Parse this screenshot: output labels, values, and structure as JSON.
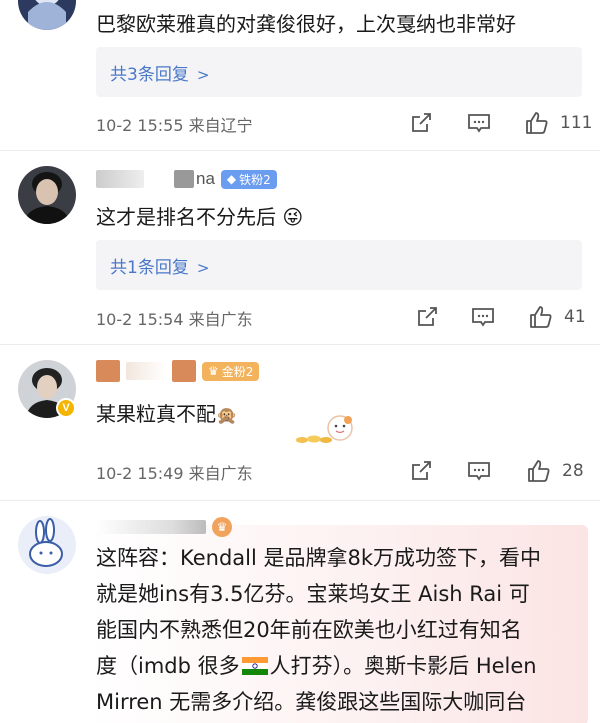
{
  "comments": [
    {
      "text": "巴黎欧莱雅真的对龚俊很好，上次戛纳也非常好",
      "reply_label": "共3条回复",
      "meta": "10-2 15:55 来自辽宁",
      "likes": "111"
    },
    {
      "badge": "铁粉2",
      "name_suffix": "na",
      "text": "这才是排名不分先后",
      "emoji": "😜",
      "reply_label": "共1条回复",
      "meta": "10-2 15:54 来自广东",
      "likes": "41"
    },
    {
      "badge": "金粉2",
      "text": "某果粒真不配",
      "emoji": "🙊",
      "meta": "10-2 15:49 来自广东",
      "likes": "28"
    },
    {
      "lines": [
        "这阵容：Kendall 是品牌拿8k万成功签下，看中",
        "就是她ins有3.5亿芬。宝莱坞女王 Aish Rai 可",
        "能国内不熟悉但20年前在欧美也小红过有知名",
        "人打芬）。奥斯卡影后 Helen",
        "Mirren 无需多介绍。龚俊跟这些国际大咖同台"
      ],
      "line4_prefix": "度（imdb 很多"
    }
  ],
  "icons": {
    "share": "share-icon",
    "comment": "comment-icon",
    "like": "thumbs-up-icon",
    "chevron": "chevron-right-icon"
  },
  "colors": {
    "link": "#4a78c9",
    "meta": "#666666",
    "reply_bg": "#f4f4f6"
  }
}
